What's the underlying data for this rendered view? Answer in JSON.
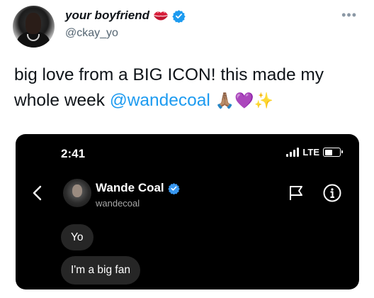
{
  "tweet": {
    "author": {
      "display_name": "your boyfriend",
      "handle": "@ckay_yo",
      "name_emoji_icon": "kiss-mark-icon",
      "verified_icon": "verified-badge-icon",
      "verified_color": "#1d9bf0"
    },
    "more_icon": "more-options-icon",
    "text_before": "big love from a BIG ICON! this made my whole week ",
    "mention": "@wandecoal",
    "emojis": "🙏🏽💜✨",
    "mention_color": "#1d9bf0"
  },
  "screenshot": {
    "status_bar": {
      "time": "2:41",
      "network": "LTE"
    },
    "chat_header": {
      "contact_name": "Wande Coal",
      "contact_handle": "wandecoal",
      "back_icon": "chevron-left-icon",
      "flag_icon": "flag-icon",
      "info_icon": "info-icon"
    },
    "messages": [
      {
        "text": "Yo"
      },
      {
        "text": "I'm a big fan"
      }
    ],
    "bubble_color": "#262626",
    "background_color": "#000000"
  }
}
